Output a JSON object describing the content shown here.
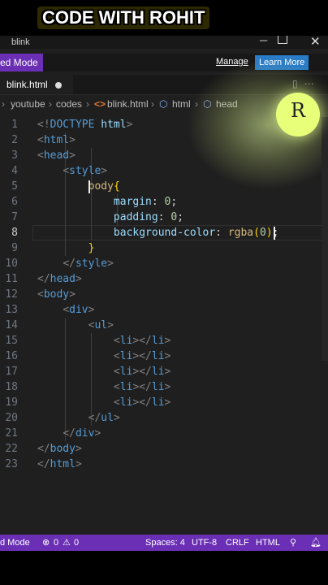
{
  "titlebar": {
    "tab_fragment": "blink"
  },
  "watermark": {
    "text": "CODE WITH ROHIT"
  },
  "banner": {
    "mode_text": "ed Mode",
    "manage": "Manage",
    "learn_more": "Learn More"
  },
  "tab": {
    "filename": "blink.html"
  },
  "breadcrumb": {
    "items": [
      "youtube",
      "codes",
      "blink.html",
      "html",
      "head"
    ]
  },
  "editor": {
    "line_numbers": [
      "1",
      "2",
      "3",
      "4",
      "5",
      "6",
      "7",
      "8",
      "9",
      "10",
      "11",
      "12",
      "13",
      "14",
      "15",
      "16",
      "17",
      "18",
      "19",
      "20",
      "21",
      "22",
      "23"
    ],
    "current_line": 8
  },
  "code": {
    "l1_a": "<!",
    "l1_b": "DOCTYPE",
    "l1_c": " html",
    "l1_d": ">",
    "l2": "html",
    "l3": "head",
    "l4": "style",
    "l5_sel": "body",
    "l5_brace": "{",
    "l6_prop": "margin",
    "l6_val": "0",
    "l7_prop": "padding",
    "l7_val": "0",
    "l8_prop": "background-color",
    "l8_fn": "rgba",
    "l8_val": "0",
    "l9_brace": "}",
    "l10": "style",
    "l11": "head",
    "l12": "body",
    "l13": "div",
    "l14": "ul",
    "li": "li",
    "l20": "ul",
    "l21": "div",
    "l22": "body",
    "l23": "html"
  },
  "logo": {
    "letter": "R"
  },
  "statusbar": {
    "mode": "d Mode",
    "errors": "0",
    "warnings": "0",
    "spaces": "Spaces: 4",
    "encoding": "UTF-8",
    "eol": "CRLF",
    "language": "HTML"
  }
}
